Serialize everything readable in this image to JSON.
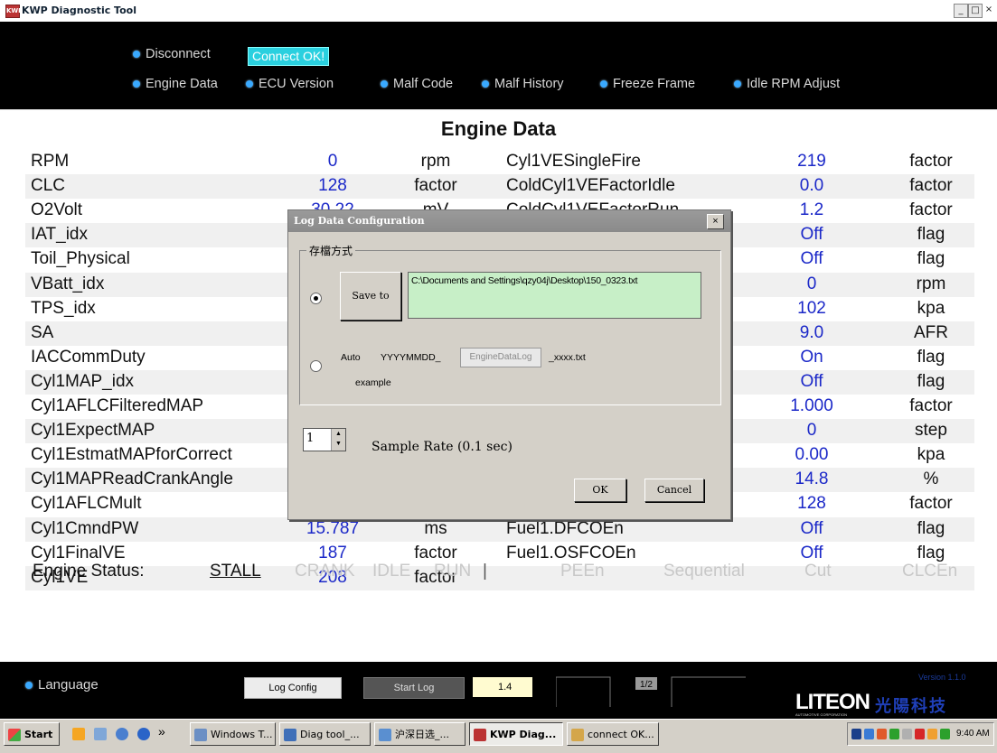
{
  "window": {
    "title": "KWP Diagnostic Tool",
    "icon_text": "KWP",
    "minimize": "_",
    "maximize": "□",
    "close": "×"
  },
  "nav": {
    "disconnect": "Disconnect",
    "status": "Connect OK!",
    "items": [
      "Engine Data",
      "ECU Version",
      "Malf Code",
      "Malf History",
      "Freeze Frame",
      "Idle RPM Adjust"
    ]
  },
  "engine_data": {
    "title": "Engine Data",
    "left": [
      {
        "name": "RPM",
        "value": "0",
        "unit": "rpm"
      },
      {
        "name": "CLC",
        "value": "128",
        "unit": "factor"
      },
      {
        "name": "O2Volt",
        "value": "30.22",
        "unit": "mV"
      },
      {
        "name": "IAT_idx",
        "value": "",
        "unit": ""
      },
      {
        "name": "Toil_Physical",
        "value": "",
        "unit": ""
      },
      {
        "name": "VBatt_idx",
        "value": "",
        "unit": ""
      },
      {
        "name": "TPS_idx",
        "value": "",
        "unit": ""
      },
      {
        "name": "SA",
        "value": "",
        "unit": ""
      },
      {
        "name": "IACCommDuty",
        "value": "",
        "unit": ""
      },
      {
        "name": "Cyl1MAP_idx",
        "value": "",
        "unit": ""
      },
      {
        "name": "Cyl1AFLCFilteredMAP",
        "value": "",
        "unit": ""
      },
      {
        "name": "Cyl1ExpectMAP",
        "value": "",
        "unit": ""
      },
      {
        "name": "Cyl1EstmatMAPforCorrect",
        "value": "",
        "unit": ""
      },
      {
        "name": "Cyl1MAPReadCrankAngle",
        "value": "",
        "unit": ""
      },
      {
        "name": "Cyl1AFLCMult",
        "value": "",
        "unit": ""
      },
      {
        "name": "Cyl1CmndPW",
        "value": "15.787",
        "unit": "ms"
      },
      {
        "name": "Cyl1FinalVE",
        "value": "187",
        "unit": "factor"
      },
      {
        "name": "Cyl1VE",
        "value": "208",
        "unit": "factor"
      }
    ],
    "right": [
      {
        "name": "Cyl1VESingleFire",
        "value": "219",
        "unit": "factor"
      },
      {
        "name": "ColdCyl1VEFactorIdle",
        "value": "0.0",
        "unit": "factor"
      },
      {
        "name": "ColdCyl1VEFactorRun",
        "value": "1.2",
        "unit": "factor"
      },
      {
        "name": "",
        "value": "Off",
        "unit": "flag"
      },
      {
        "name": "",
        "value": "Off",
        "unit": "flag"
      },
      {
        "name": "",
        "value": "0",
        "unit": "rpm"
      },
      {
        "name": "",
        "value": "102",
        "unit": "kpa"
      },
      {
        "name": "",
        "value": "9.0",
        "unit": "AFR"
      },
      {
        "name": "",
        "value": "On",
        "unit": "flag"
      },
      {
        "name": "",
        "value": "Off",
        "unit": "flag"
      },
      {
        "name": "",
        "value": "1.000",
        "unit": "factor"
      },
      {
        "name": "",
        "value": "0",
        "unit": "step"
      },
      {
        "name": "",
        "value": "0.00",
        "unit": "kpa"
      },
      {
        "name": "",
        "value": "14.8",
        "unit": "%"
      },
      {
        "name": "",
        "value": "128",
        "unit": "factor"
      },
      {
        "name": "Fuel1.DFCOEn",
        "value": "Off",
        "unit": "flag"
      },
      {
        "name": "Fuel1.OSFCOEn",
        "value": "Off",
        "unit": "flag"
      }
    ],
    "status": {
      "label": "Engine Status:",
      "stall": "STALL",
      "crank": "CRANK",
      "idle": "IDLE",
      "run": "RUN",
      "sep": "|",
      "peen": "PEEn",
      "sequential": "Sequential",
      "cut": "Cut",
      "clcen": "CLCEn"
    }
  },
  "dialog": {
    "title": "Log Data Configuration",
    "close": "×",
    "group_label": "存檔方式",
    "save_to": "Save to",
    "path": "C:\\Documents and Settings\\qzy04j\\Desktop\\150_0323.txt",
    "auto": "Auto",
    "date_fmt": "YYYYMMDD_",
    "file_name": "EngineDataLog",
    "suffix": "_xxxx.txt",
    "example": "example",
    "sample_value": "1",
    "sample_label": "Sample Rate (0.1 sec)",
    "ok": "OK",
    "cancel": "Cancel"
  },
  "bottom": {
    "language": "Language",
    "log_config": "Log Config",
    "start_log": "Start Log",
    "rate": "1.4",
    "page": "1/2",
    "brand": "LITEON",
    "brand_sub": "AUTOMOTIVE CORPORATION",
    "brand_cn": "光陽科技",
    "version": "Version 1.1.0"
  },
  "taskbar": {
    "start": "Start",
    "quick_more": "»",
    "tasks": [
      "Windows T...",
      "Diag tool_...",
      "沪深日选_...",
      "KWP Diag...",
      "connect OK..."
    ],
    "clock": "9:40 AM"
  }
}
